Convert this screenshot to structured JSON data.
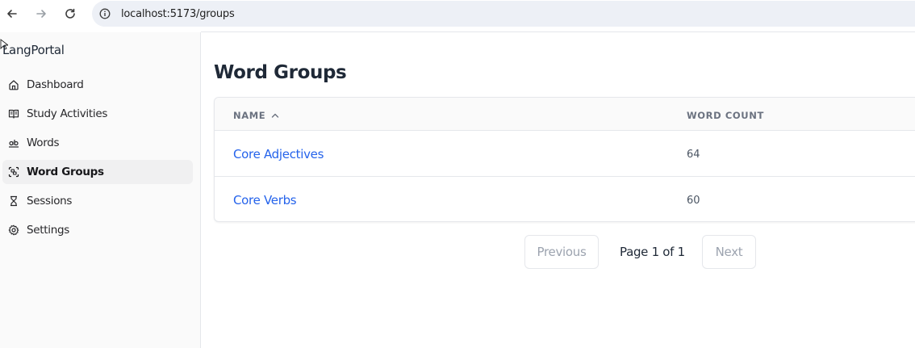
{
  "browser": {
    "url": "localhost:5173/groups",
    "back_icon": "arrow-left-icon",
    "forward_icon": "arrow-right-icon",
    "reload_icon": "reload-icon",
    "info_icon": "info-icon"
  },
  "sidebar": {
    "brand": "LangPortal",
    "items": [
      {
        "label": "Dashboard",
        "icon": "home-icon",
        "active": false
      },
      {
        "label": "Study Activities",
        "icon": "book-open-icon",
        "active": false
      },
      {
        "label": "Words",
        "icon": "ab-text-icon",
        "active": false
      },
      {
        "label": "Word Groups",
        "icon": "group-scan-icon",
        "active": true
      },
      {
        "label": "Sessions",
        "icon": "hourglass-icon",
        "active": false
      },
      {
        "label": "Settings",
        "icon": "gear-icon",
        "active": false
      }
    ]
  },
  "main": {
    "title": "Word Groups",
    "table": {
      "columns": [
        "NAME",
        "WORD COUNT"
      ],
      "sort_icon": "chevron-up-icon",
      "rows": [
        {
          "name": "Core Adjectives",
          "count": "64"
        },
        {
          "name": "Core Verbs",
          "count": "60"
        }
      ]
    },
    "pagination": {
      "previous": "Previous",
      "info": "Page 1 of 1",
      "next": "Next"
    }
  },
  "colors": {
    "link": "#2563eb",
    "active_bg": "#f0f0f1",
    "url_bar": "#edf0f6"
  }
}
